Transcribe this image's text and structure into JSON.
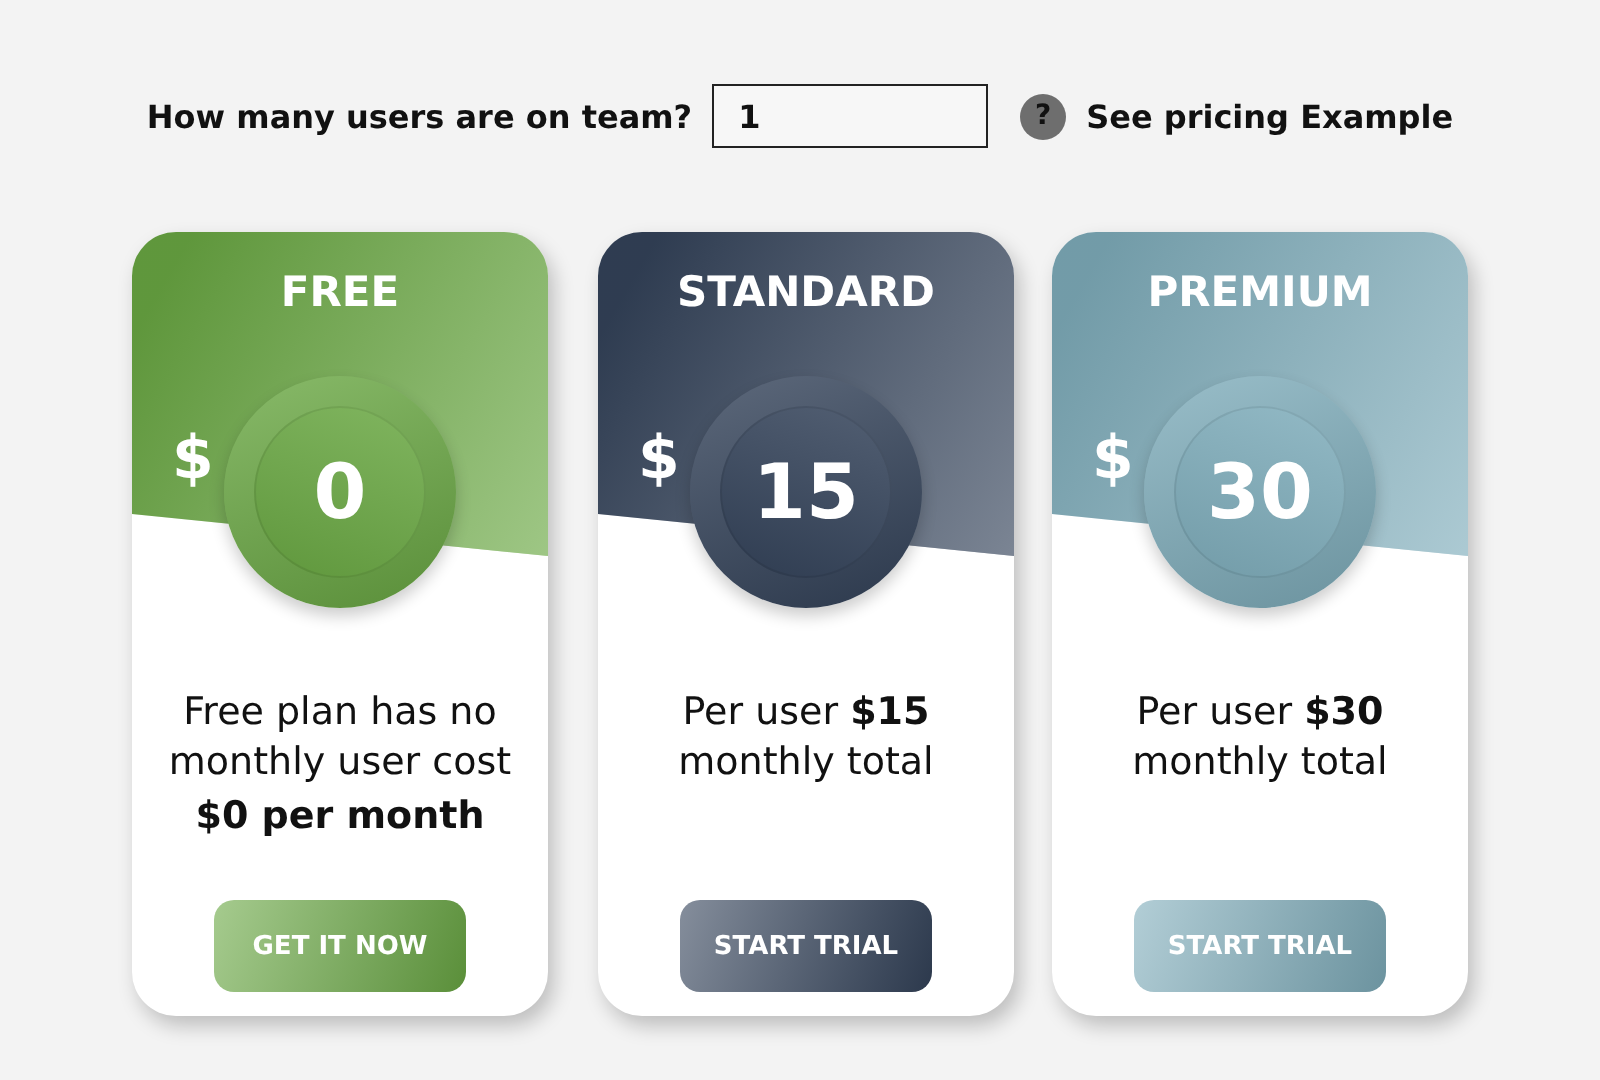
{
  "header": {
    "question": "How many users are on team?",
    "users_field": {
      "value": "1"
    },
    "help_icon": "?",
    "link": "See pricing Example"
  },
  "plans": [
    {
      "name": "FREE",
      "color": "#6aa843",
      "currency": "$",
      "price": "0",
      "description": "Free plan has no monthly user cost",
      "note": "$0 per month",
      "button": "GET IT NOW"
    },
    {
      "name": "STANDARD",
      "color": "#34435a",
      "currency": "$",
      "price": "15",
      "description": "Per user **$15** monthly total",
      "button": "START TRIAL"
    },
    {
      "name": "PREMIUM",
      "color": "#7fadbb",
      "currency": "$",
      "price": "30",
      "description": "Per user **$30** monthly total",
      "button": "START TRIAL"
    }
  ]
}
